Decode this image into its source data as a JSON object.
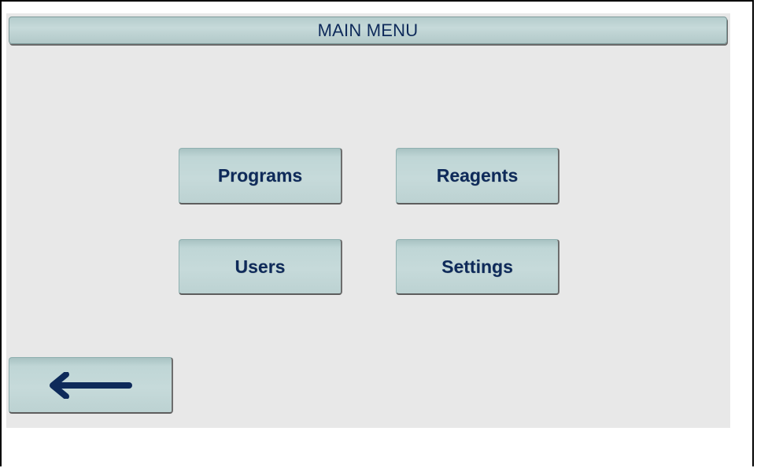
{
  "header": {
    "title": "MAIN MENU"
  },
  "menu": {
    "buttons": [
      {
        "id": "programs",
        "label": "Programs"
      },
      {
        "id": "reagents",
        "label": "Reagents"
      },
      {
        "id": "users",
        "label": "Users"
      },
      {
        "id": "settings",
        "label": "Settings"
      }
    ]
  },
  "navigation": {
    "back_icon": "left-arrow-icon"
  },
  "colors": {
    "screen_background": "#e8e8e8",
    "button_face": "#c6dada",
    "text": "#0e2a5a"
  }
}
